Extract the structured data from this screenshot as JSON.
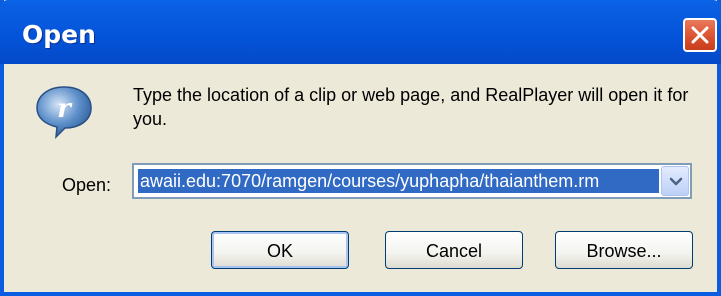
{
  "window": {
    "title": "Open"
  },
  "dialog": {
    "message": "Type the location of a clip or web page, and RealPlayer will open it for you.",
    "open_label": "Open:",
    "open_value": "awaii.edu:7070/ramgen/courses/yuphapha/thaianthem.rm"
  },
  "buttons": {
    "ok": "OK",
    "cancel": "Cancel",
    "browse": "Browse..."
  },
  "icons": {
    "close": "close-icon",
    "app": "realplayer-icon",
    "dropdown": "chevron-down-icon"
  }
}
